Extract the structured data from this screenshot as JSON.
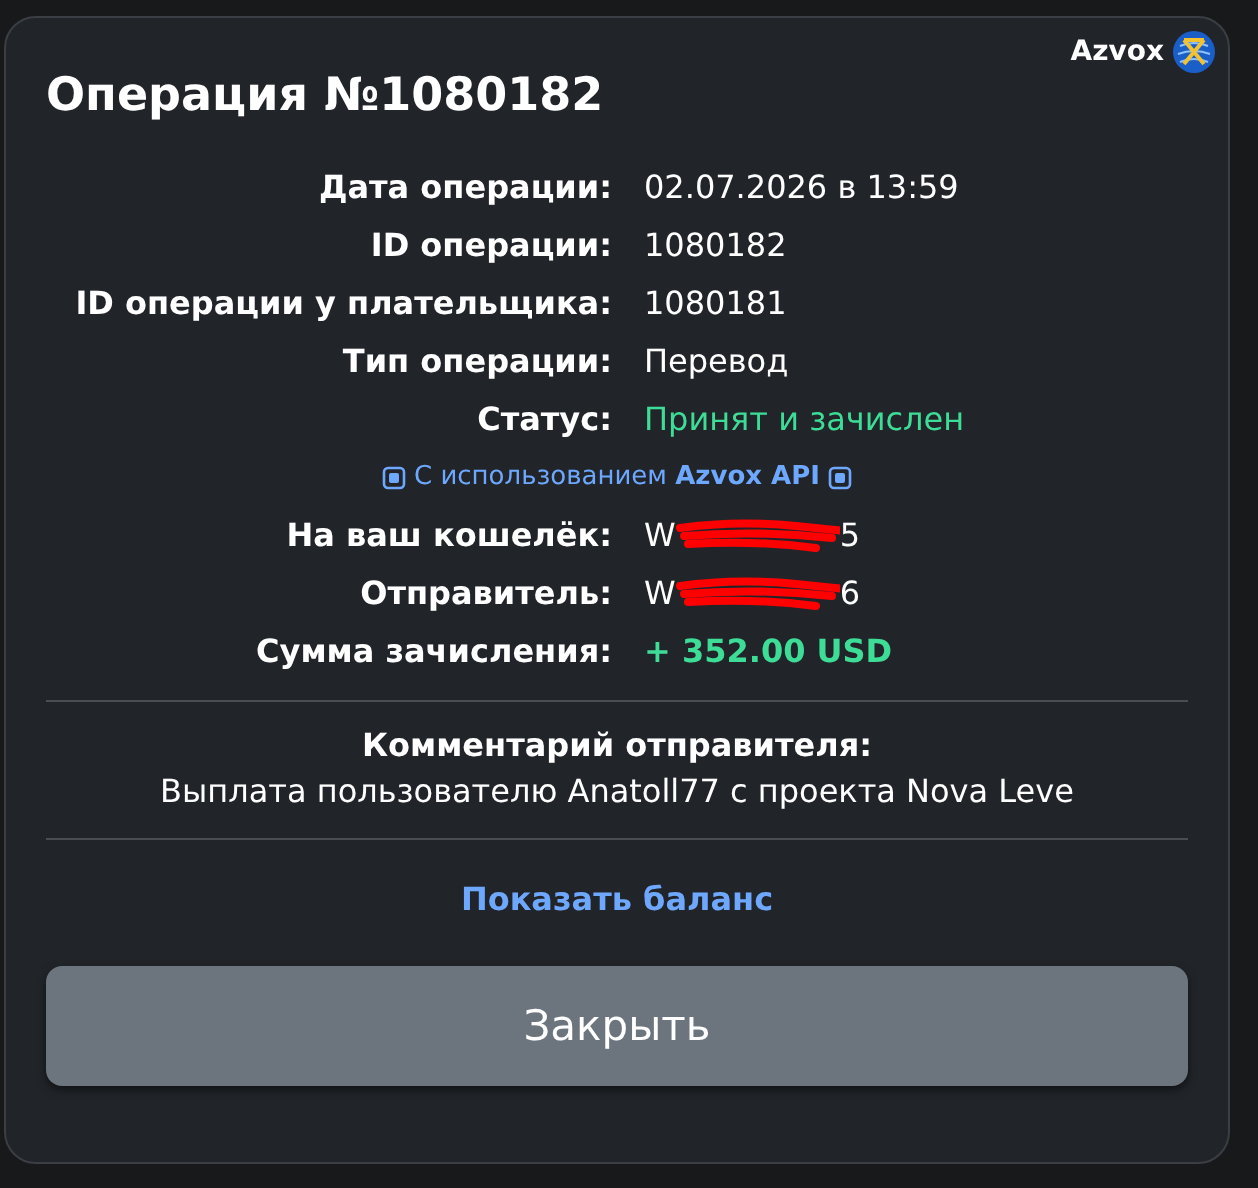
{
  "brand": {
    "name": "Azvox"
  },
  "title": "Операция №1080182",
  "details": [
    {
      "kind": "text",
      "label": "Дата операции:",
      "value": "02.07.2026 в 13:59"
    },
    {
      "kind": "text",
      "label": "ID операции:",
      "value": "1080182"
    },
    {
      "kind": "text",
      "label": "ID операции у плательщика:",
      "value": "1080181"
    },
    {
      "kind": "text",
      "label": "Тип операции:",
      "value": "Перевод"
    },
    {
      "kind": "status",
      "label": "Статус:",
      "value": "Принят и зачислен"
    },
    {
      "kind": "api",
      "value": "С использованием **Azvox API**"
    },
    {
      "kind": "redacted",
      "label": "На ваш кошелёк:",
      "start": "W",
      "end": "5"
    },
    {
      "kind": "redacted",
      "label": "Отправитель:",
      "start": "W",
      "end": "6"
    },
    {
      "kind": "amount",
      "label": "Сумма зачисления:",
      "value": "+ 352.00 USD"
    }
  ],
  "comment": {
    "heading": "Комментарий отправителя:",
    "text": "Выплата пользователю Anatoll77 с проекта Nova Leve"
  },
  "link": "Показать баланс",
  "button": "Закрыть"
}
